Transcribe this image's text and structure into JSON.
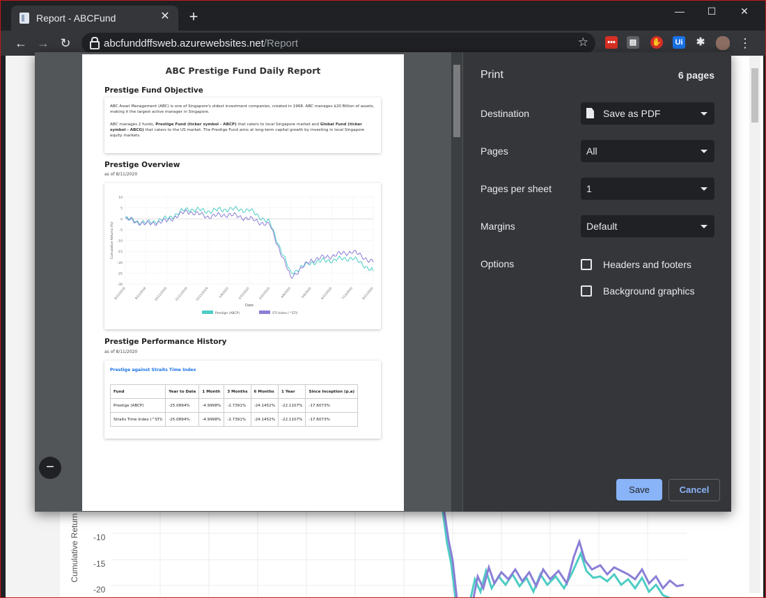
{
  "browser": {
    "tab_title": "Report - ABCFund",
    "url_host": "abcfunddffsweb.azurewebsites.net",
    "url_path": "/Report",
    "ext_ui_label": "Ui"
  },
  "background_chart": {
    "ylabel": "Cumulative Return",
    "ticks": [
      "-10",
      "-15",
      "-20"
    ]
  },
  "report": {
    "title": "ABC Prestige Fund Daily Report",
    "objective_heading": "Prestige Fund Objective",
    "objective_p1": "ABC Asset Management (ABC) is one of Singapore's oldest investment companies, created in 1968. ABC manages $20 Billion of assets, making it the largest active manager in Singapore.",
    "objective_p2_a": "ABC manages 2 funds, ",
    "objective_p2_b": "Prestige Fund (ticker symbol - ABCP)",
    "objective_p2_c": " that caters to local Singapore market and ",
    "objective_p2_d": "Global Fund (ticker symbol - ABCG)",
    "objective_p2_e": " that caters to the US market. The Prestige Fund aims at long-term capital growth by investing in local Singapore equity markets.",
    "overview_heading": "Prestige Overview",
    "overview_asof": "as of 8/11/2020",
    "history_heading": "Prestige Performance History",
    "history_asof": "as of 8/11/2020",
    "table_link": "Prestige against Straits Time Index",
    "table_headers": [
      "Fund",
      "Year to Date",
      "1 Month",
      "3 Months",
      "6 Months",
      "1 Year",
      "Since Inception (p.a)"
    ],
    "table_rows": [
      [
        "Prestige (ABCP)",
        "-25.0894%",
        "-4.9998%",
        "-2.7391%",
        "-24.1452%",
        "-22.1107%",
        "-17.6073%"
      ],
      [
        "Straits Time Index (^STI)",
        "-25.0894%",
        "-4.9998%",
        "-2.7391%",
        "-24.1452%",
        "-22.1107%",
        "-17.6073%"
      ]
    ]
  },
  "chart_data": {
    "type": "line",
    "title": "",
    "xlabel": "Date",
    "ylabel": "Cumulative Returns (%)",
    "ylim": [
      -30,
      10
    ],
    "yticks": [
      "10",
      "5",
      "0",
      "-5",
      "-10",
      "-15",
      "-20",
      "-25",
      "-30"
    ],
    "x": [
      "8/12/2019",
      "9/11/2019",
      "10/11/2019",
      "11/11/2019",
      "12/11/2019",
      "1/9/2020",
      "2/10/2020",
      "3/10/2020",
      "4/8/2020",
      "5/8/2020",
      "6/11/2020",
      "7/13/2020",
      "8/11/2020"
    ],
    "series": [
      {
        "name": "Prestige (ABCP)",
        "color": "#4ecdc4",
        "values": [
          0,
          -2,
          0,
          4.5,
          3.5,
          4.5,
          4,
          -2,
          -25,
          -20,
          -19,
          -18,
          -24
        ]
      },
      {
        "name": "STI Index (^STI)",
        "color": "#8a7fd6",
        "values": [
          0,
          -2.5,
          -1,
          3.5,
          1,
          2,
          0,
          -3,
          -27,
          -19,
          -17,
          -15,
          -20
        ]
      }
    ],
    "legend": "bottom",
    "grid": true
  },
  "print": {
    "title": "Print",
    "pages_count": "6 pages",
    "destination_label": "Destination",
    "destination_value": "Save as PDF",
    "pages_label": "Pages",
    "pages_value": "All",
    "pps_label": "Pages per sheet",
    "pps_value": "1",
    "margins_label": "Margins",
    "margins_value": "Default",
    "options_label": "Options",
    "opt_headers": "Headers and footers",
    "opt_bg": "Background graphics",
    "save": "Save",
    "cancel": "Cancel"
  }
}
